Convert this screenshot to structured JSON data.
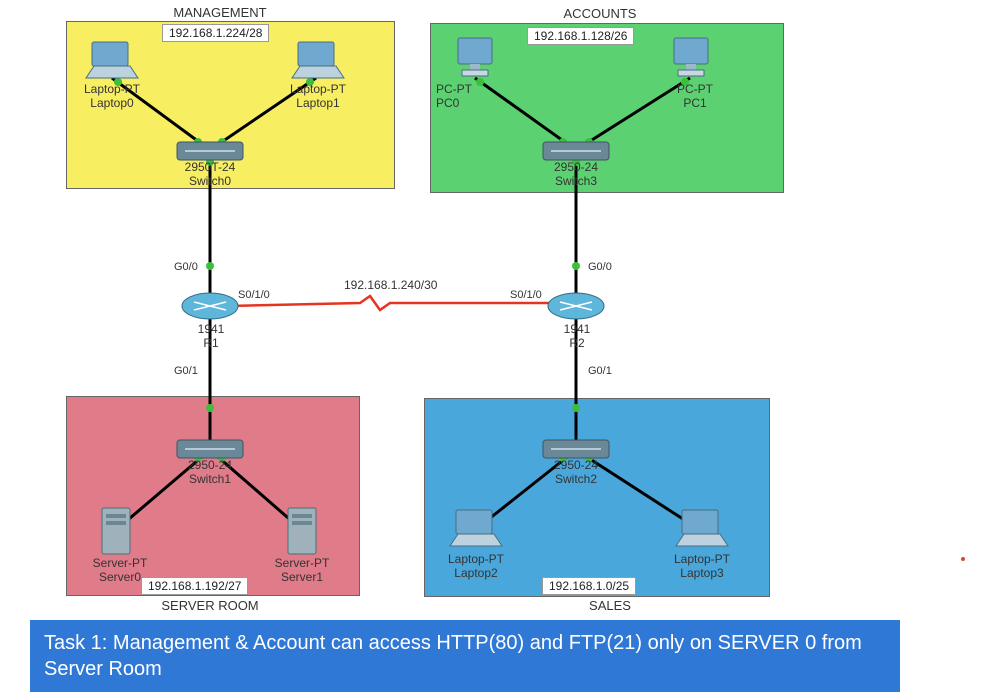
{
  "zones": {
    "management": {
      "label": "MANAGEMENT",
      "subnet": "192.168.1.224/28",
      "color": "#f7ee62"
    },
    "accounts": {
      "label": "ACCOUNTS",
      "subnet": "192.168.1.128/26",
      "color": "#5cd171"
    },
    "serverroom": {
      "label": "SERVER ROOM",
      "subnet": "192.168.1.192/27",
      "color": "#e07b8a"
    },
    "sales": {
      "label": "SALES",
      "subnet": "192.168.1.0/25",
      "color": "#4aa7db"
    }
  },
  "devices": {
    "laptop0": {
      "line1": "Laptop-PT",
      "line2": "Laptop0"
    },
    "laptop1": {
      "line1": "Laptop-PT",
      "line2": "Laptop1"
    },
    "laptop2": {
      "line1": "Laptop-PT",
      "line2": "Laptop2"
    },
    "laptop3": {
      "line1": "Laptop-PT",
      "line2": "Laptop3"
    },
    "pc0": {
      "line1": "PC-PT",
      "line2": "PC0"
    },
    "pc1": {
      "line1": "PC-PT",
      "line2": "PC1"
    },
    "switch0": {
      "line1": "2950T-24",
      "line2": "Switch0"
    },
    "switch1": {
      "line1": "2950-24",
      "line2": "Switch1"
    },
    "switch2": {
      "line1": "2950-24",
      "line2": "Switch2"
    },
    "switch3": {
      "line1": "2950-24",
      "line2": "Switch3"
    },
    "r1": {
      "line1": "1941",
      "line2": "R1"
    },
    "r2": {
      "line1": "1941",
      "line2": "R2"
    },
    "server0": {
      "line1": "Server-PT",
      "line2": "Server0"
    },
    "server1": {
      "line1": "Server-PT",
      "line2": "Server1"
    }
  },
  "interfaces": {
    "r1_g00": "G0/0",
    "r1_g01": "G0/1",
    "r1_s010": "S0/1/0",
    "r2_g00": "G0/0",
    "r2_g01": "G0/1",
    "r2_s010": "S0/1/0"
  },
  "link_subnet": "192.168.1.240/30",
  "task": "Task 1: Management & Account can access HTTP(80) and FTP(21) only on SERVER 0 from Server Room",
  "task_bg": "#2f78d6"
}
